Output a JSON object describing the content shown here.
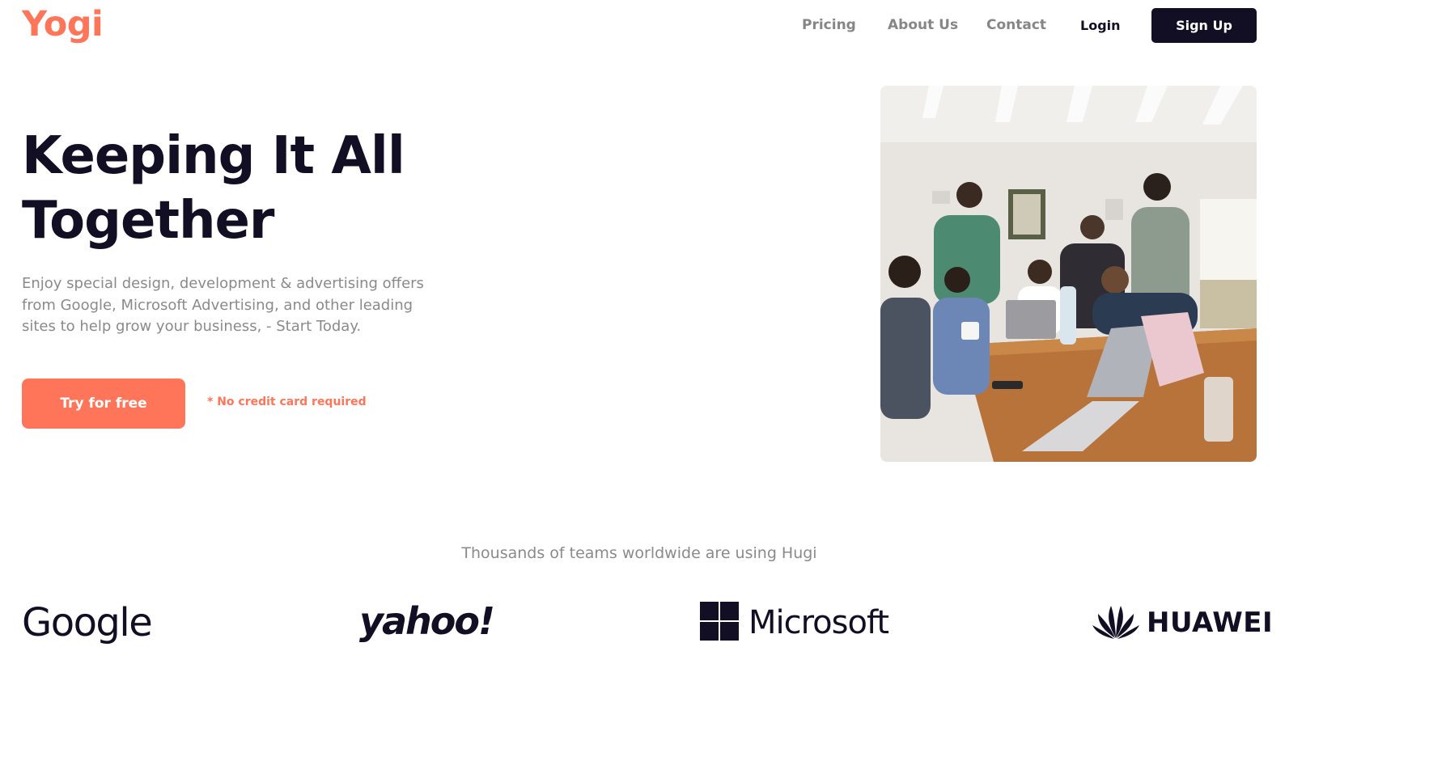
{
  "header": {
    "logo": "Yogi",
    "nav": {
      "pricing": "Pricing",
      "about": "About Us",
      "contact": "Contact",
      "login": "Login"
    },
    "signup_label": "Sign Up"
  },
  "hero": {
    "title": "Keeping It All Together",
    "description": "Enjoy special design, development & advertising offers from Google, Microsoft Advertising, and other leading sites to help grow your business, - Start Today.",
    "cta_label": "Try for free",
    "cta_note": "* No credit card required"
  },
  "trust": {
    "heading": "Thousands of teams worldwide are using Hugi",
    "brands": {
      "google": "Google",
      "yahoo": "yahoo!",
      "microsoft": "Microsoft",
      "huawei": "HUAWEI"
    }
  },
  "colors": {
    "accent": "#fe7559",
    "dark": "#120f24",
    "muted": "#8a8a8a"
  },
  "icons": [
    "microsoft-logo-icon",
    "huawei-logo-icon",
    "team-photo"
  ]
}
